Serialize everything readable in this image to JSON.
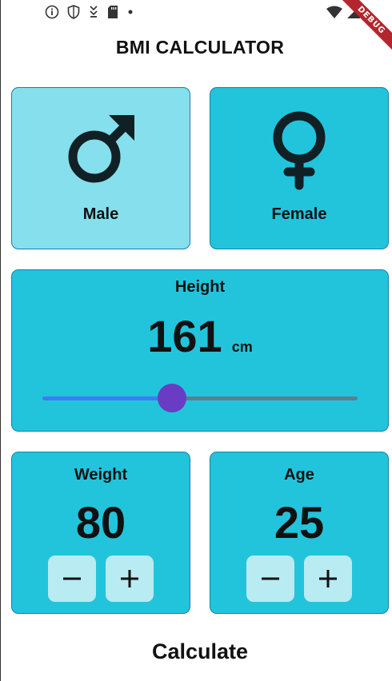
{
  "app": {
    "title": "BMI CALCULATOR",
    "debug_banner": "DEBUG"
  },
  "status_bar": {
    "left_icons": [
      "info-icon",
      "shield-icon",
      "download-icon",
      "sd-card-icon",
      "dot-icon"
    ],
    "right_icons": [
      "wifi-icon",
      "signal-icon"
    ]
  },
  "gender": {
    "male": {
      "label": "Male",
      "icon": "male-symbol-icon",
      "selected": true
    },
    "female": {
      "label": "Female",
      "icon": "female-symbol-icon",
      "selected": false
    }
  },
  "height": {
    "label": "Height",
    "value": "161",
    "unit": "cm",
    "slider_fraction": 0.41
  },
  "weight": {
    "label": "Weight",
    "value": "80",
    "minus": "minus-icon",
    "plus": "plus-icon"
  },
  "age": {
    "label": "Age",
    "value": "25",
    "minus": "minus-icon",
    "plus": "plus-icon"
  },
  "calculate": {
    "label": "Calculate"
  },
  "colors": {
    "card": "#22c4dc",
    "card_selected": "#86dfec",
    "card_border": "#1b7fa8",
    "button_bg": "#b9ebf2",
    "slider_active": "#3f7bf2",
    "slider_inactive": "#5b7f8e",
    "slider_thumb": "#6a3cc3",
    "debug_ribbon": "#b3262e"
  }
}
